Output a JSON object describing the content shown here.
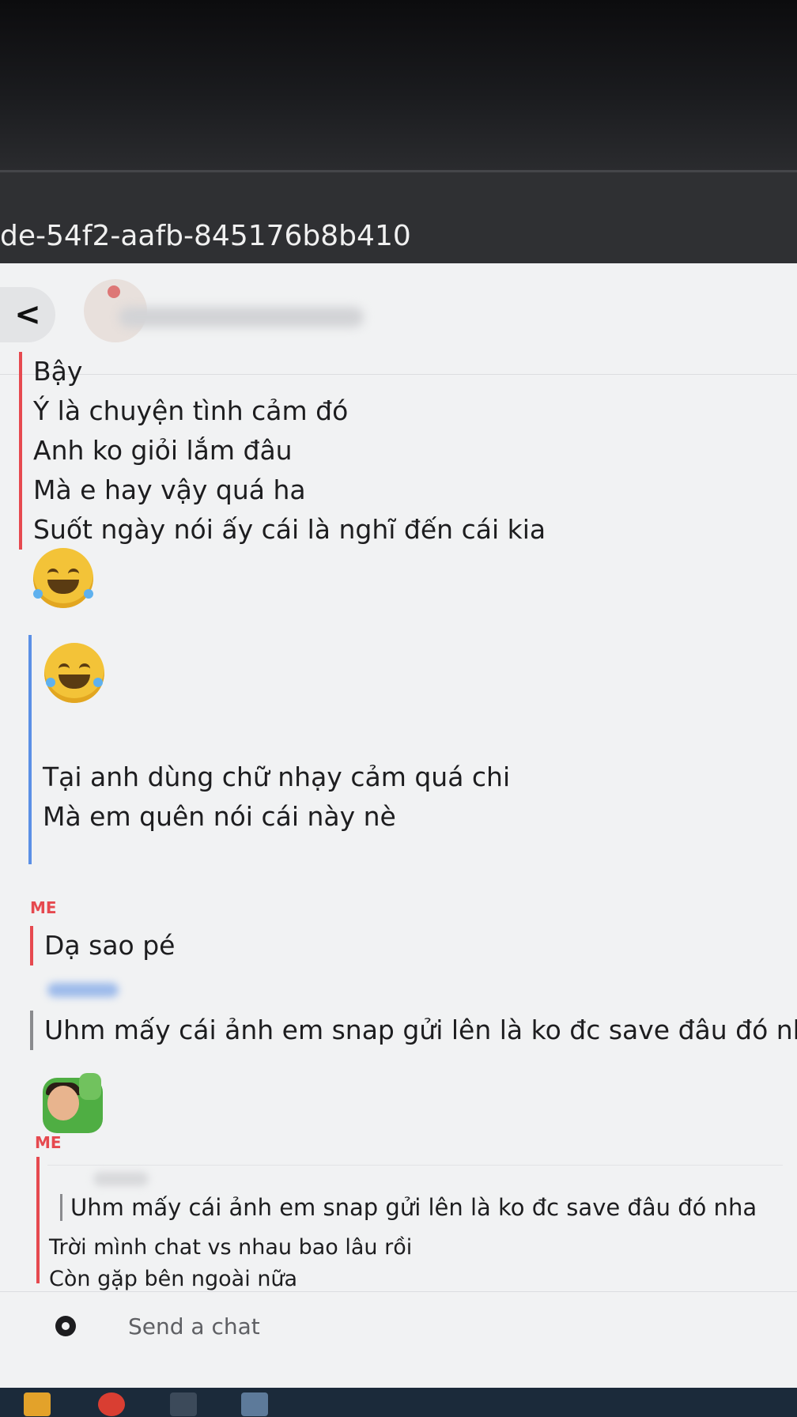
{
  "browser": {
    "url_fragment": "de-54f2-aafb-845176b8b410"
  },
  "header": {
    "back_label": "<"
  },
  "messages": {
    "group1": [
      "Bậy",
      "Ý là chuyện tình cảm đó",
      "Anh ko giỏi lắm đâu",
      "Mà e hay vậy quá ha",
      "Suốt ngày nói ấy cái là nghĩ đến cái kia"
    ],
    "group2": [
      "Tại anh dùng chữ nhạy cảm quá chi",
      "Mà em quên nói cái này nè"
    ],
    "me1": {
      "sender": "ME",
      "text": "Dạ sao pé"
    },
    "friend": {
      "text": "Uhm mấy cái ảnh em snap gửi lên là ko đc save đâu đó nha"
    },
    "me2": {
      "sender": "ME",
      "quoted": "Uhm mấy cái ảnh em snap gửi lên là ko đc save đâu đó nha",
      "lines": [
        "Trời mình chat vs nhau bao lâu rồi",
        "Còn gặp bên ngoài nữa"
      ]
    }
  },
  "input": {
    "placeholder": "Send a chat"
  },
  "icons": {
    "back": "chevron-left-icon",
    "camera": "camera-icon",
    "emoji_sad_laugh": "crying-laughing-bitmoji-icon",
    "emoji_rofl": "rofl-emoji-icon",
    "emoji_thumbs": "thumbs-up-bitmoji-icon"
  },
  "colors": {
    "me": "#e6494f",
    "friend": "#5b90e6",
    "accent_yellow": "#f3c338"
  }
}
